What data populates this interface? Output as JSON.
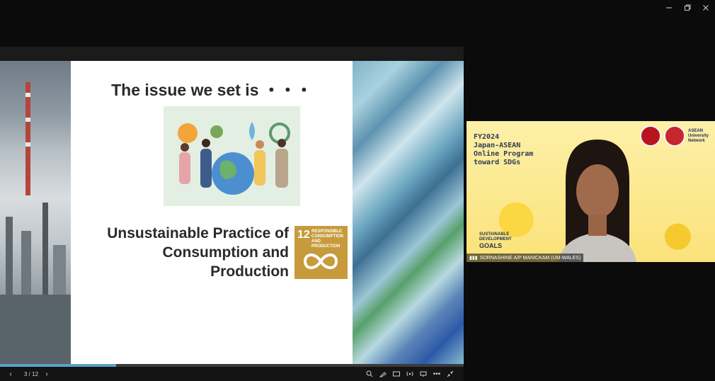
{
  "window": {
    "minimize_icon": "minimize-icon",
    "restore_icon": "restore-icon",
    "close_icon": "close-icon"
  },
  "slide": {
    "title": "The issue we set is ・・・",
    "main_line1": "Unsustainable Practice of",
    "main_line2": "Consumption and",
    "main_line3": "Production",
    "sdg_number": "12",
    "sdg_label": "RESPONSIBLE CONSUMPTION AND PRODUCTION",
    "sdg_color": "#c79a3c"
  },
  "controls": {
    "page_indicator": "3 / 12",
    "progress_fraction": 0.25
  },
  "video": {
    "title_line1": "FY2024",
    "title_line2": "Japan-ASEAN",
    "title_line3": "Online Program",
    "title_line4": "toward SDGs",
    "asean_logo_text": "ASEAN University Network",
    "sdg_logo_line1": "SUSTAINABLE",
    "sdg_logo_line2": "DEVELOPMENT",
    "sdg_logo_line3": "GOALS",
    "participant_name": "SORNASHINE A/P MANICKAM (UM-WALES)"
  }
}
